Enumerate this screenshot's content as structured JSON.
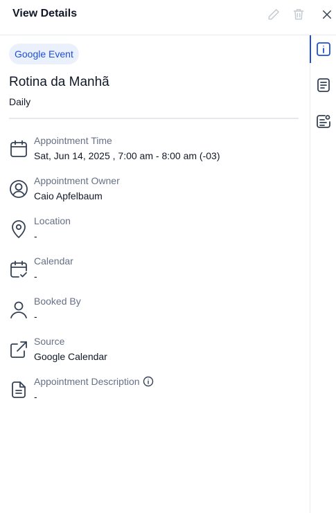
{
  "header": {
    "title": "View Details",
    "icons": [
      "pencil-icon",
      "trash-icon",
      "close-icon"
    ]
  },
  "event": {
    "badge": "Google Event",
    "title": "Rotina da Manhã",
    "recurrence": "Daily"
  },
  "details": {
    "appointment_time": {
      "label": "Appointment Time",
      "value": "Sat, Jun 14, 2025 , 7:00 am - 8:00 am (-03)",
      "icon": "calendar-icon"
    },
    "owner": {
      "label": "Appointment Owner",
      "value": "Caio Apfelbaum",
      "icon": "user-circle-icon"
    },
    "location": {
      "label": "Location",
      "value": "-",
      "icon": "location-pin-icon"
    },
    "calendar": {
      "label": "Calendar",
      "value": "-",
      "icon": "calendar-check-icon"
    },
    "booked_by": {
      "label": "Booked By",
      "value": "-",
      "icon": "user-icon"
    },
    "source": {
      "label": "Source",
      "value": "Google Calendar",
      "icon": "external-link-icon"
    },
    "description": {
      "label": "Appointment Description",
      "value": "-",
      "icon": "document-icon"
    }
  },
  "sidebar": {
    "items": [
      {
        "icon": "info-icon",
        "active": true
      },
      {
        "icon": "notes-icon",
        "active": false
      },
      {
        "icon": "contact-card-icon",
        "active": false
      }
    ]
  },
  "colors": {
    "accent": "#1d4ed8",
    "badge_bg": "#eaf1fd",
    "muted_text": "#667085",
    "primary_text": "#101828"
  }
}
